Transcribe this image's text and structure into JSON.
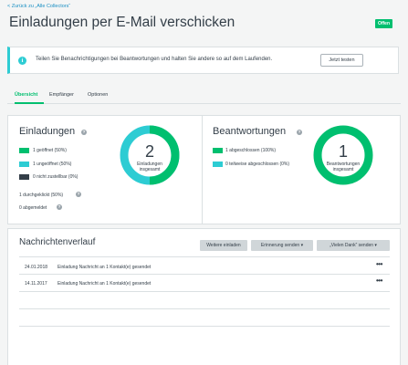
{
  "header": {
    "back_link": "< Zurück zu „Alle Collectors“",
    "title": "Einladungen per E-Mail verschicken",
    "status_badge": "Offen"
  },
  "banner": {
    "icon": "info-icon",
    "text": "Teilen Sie Benachrichtigungen bei Beantwortungen und halten Sie andere so auf dem Laufenden.",
    "button_label": "Jetzt testen"
  },
  "tabs": [
    {
      "label": "Übersicht",
      "active": true
    },
    {
      "label": "Empfänger",
      "active": false
    },
    {
      "label": "Optionen",
      "active": false
    }
  ],
  "invitations": {
    "title": "Einladungen",
    "legend": [
      {
        "label": "1 geöffnet (50%)",
        "color": "#00bf6f",
        "value": 1
      },
      {
        "label": "1 ungeöffnet (50%)",
        "color": "#2dccd3",
        "value": 1
      },
      {
        "label": "0 nicht zustellbar (0%)",
        "color": "#333e48",
        "value": 0
      }
    ],
    "clicked": "1 durchgeklickt (50%)",
    "unsubscribed": "0 abgemeldet",
    "total": "2",
    "total_caption_line1": "Einladungen",
    "total_caption_line2": "insgesamt"
  },
  "responses": {
    "title": "Beantwortungen",
    "legend": [
      {
        "label": "1 abgeschlossen (100%)",
        "color": "#00bf6f",
        "value": 1
      },
      {
        "label": "0 teilweise abgeschlossen (0%)",
        "color": "#2dccd3",
        "value": 0
      }
    ],
    "total": "1",
    "total_caption_line1": "Beantwortungen",
    "total_caption_line2": "insgesamt"
  },
  "history": {
    "title": "Nachrichtenverlauf",
    "buttons": [
      "Weitere einladen",
      "Erinnerung senden ▾",
      "„Vielen Dank“ senden ▾"
    ],
    "rows": [
      {
        "date": "24.01.2018",
        "description": "Einladung Nachricht an 1 Kontakt(e) gesendet",
        "more": "•••"
      },
      {
        "date": "14.11.2017",
        "description": "Einladung Nachricht an 1 Kontakt(e) gesendet",
        "more": "•••"
      }
    ]
  }
}
